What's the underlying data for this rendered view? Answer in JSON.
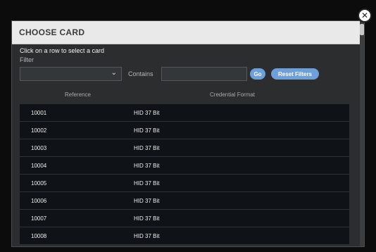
{
  "dialog": {
    "title": "CHOOSE CARD",
    "close_icon": "close-icon",
    "instructions": "Click on a row to select a card",
    "filter_label": "Filter",
    "filter_value": "",
    "contains_label": "Contains",
    "contains_value": "",
    "go_label": "Go",
    "reset_label": "Reset Filters"
  },
  "table": {
    "columns": [
      "Reference",
      "Credential Format"
    ],
    "rows": [
      {
        "reference": "10001",
        "format": "HID 37 Bit"
      },
      {
        "reference": "10002",
        "format": "HID 37 Bit"
      },
      {
        "reference": "10003",
        "format": "HID 37 Bit"
      },
      {
        "reference": "10004",
        "format": "HID 37 Bit"
      },
      {
        "reference": "10005",
        "format": "HID 37 Bit"
      },
      {
        "reference": "10006",
        "format": "HID 37 Bit"
      },
      {
        "reference": "10007",
        "format": "HID 37 Bit"
      },
      {
        "reference": "10008",
        "format": "HID 37 Bit"
      }
    ]
  },
  "colors": {
    "accent": "#6f9fd8",
    "row_bg": "#0f1216",
    "dialog_bg": "#2b2d2f",
    "header_bg": "#e9e9e9"
  }
}
